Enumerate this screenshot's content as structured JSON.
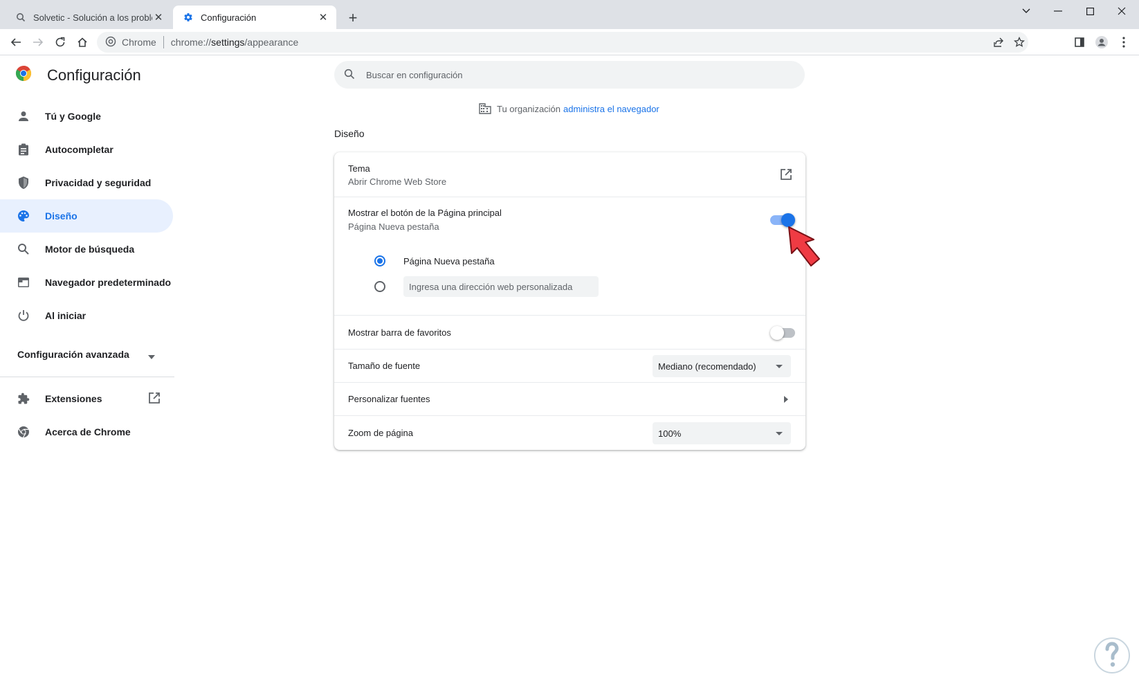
{
  "tabs": [
    {
      "title": "Solvetic - Solución a los problem",
      "icon": "search-icon"
    },
    {
      "title": "Configuración",
      "icon": "gear-icon"
    }
  ],
  "omnibox": {
    "site_chip": "Chrome",
    "url_scheme": "chrome://",
    "url_host": "settings",
    "url_path": "/appearance"
  },
  "sidebar": {
    "title": "Configuración",
    "items": [
      {
        "label": "Tú y Google",
        "icon": "person-icon"
      },
      {
        "label": "Autocompletar",
        "icon": "clipboard-icon"
      },
      {
        "label": "Privacidad y seguridad",
        "icon": "shield-icon"
      },
      {
        "label": "Diseño",
        "icon": "palette-icon",
        "active": true
      },
      {
        "label": "Motor de búsqueda",
        "icon": "search-icon"
      },
      {
        "label": "Navegador predeterminado",
        "icon": "browser-icon"
      },
      {
        "label": "Al iniciar",
        "icon": "power-icon"
      }
    ],
    "advanced_label": "Configuración avanzada",
    "extra_items": [
      {
        "label": "Extensiones",
        "icon": "puzzle-icon"
      },
      {
        "label": "Acerca de Chrome",
        "icon": "chrome-icon"
      }
    ]
  },
  "search": {
    "placeholder": "Buscar en configuración"
  },
  "org_notice": {
    "text": "Tu organización",
    "link": "administra el navegador"
  },
  "section": {
    "title": "Diseño",
    "theme": {
      "label": "Tema",
      "sub": "Abrir Chrome Web Store"
    },
    "home_button": {
      "label": "Mostrar el botón de la Página principal",
      "sub": "Página Nueva pestaña",
      "enabled": true,
      "option_newtab": "Página Nueva pestaña",
      "option_custom_placeholder": "Ingresa una dirección web personalizada"
    },
    "bookmarks_bar": {
      "label": "Mostrar barra de favoritos",
      "enabled": false
    },
    "font_size": {
      "label": "Tamaño de fuente",
      "value": "Mediano (recomendado)"
    },
    "custom_fonts": {
      "label": "Personalizar fuentes"
    },
    "page_zoom": {
      "label": "Zoom de página",
      "value": "100%"
    }
  },
  "colors": {
    "accent": "#1a73e8",
    "active_nav_bg": "#e8f0fe",
    "cursor": "#ef3b43"
  }
}
